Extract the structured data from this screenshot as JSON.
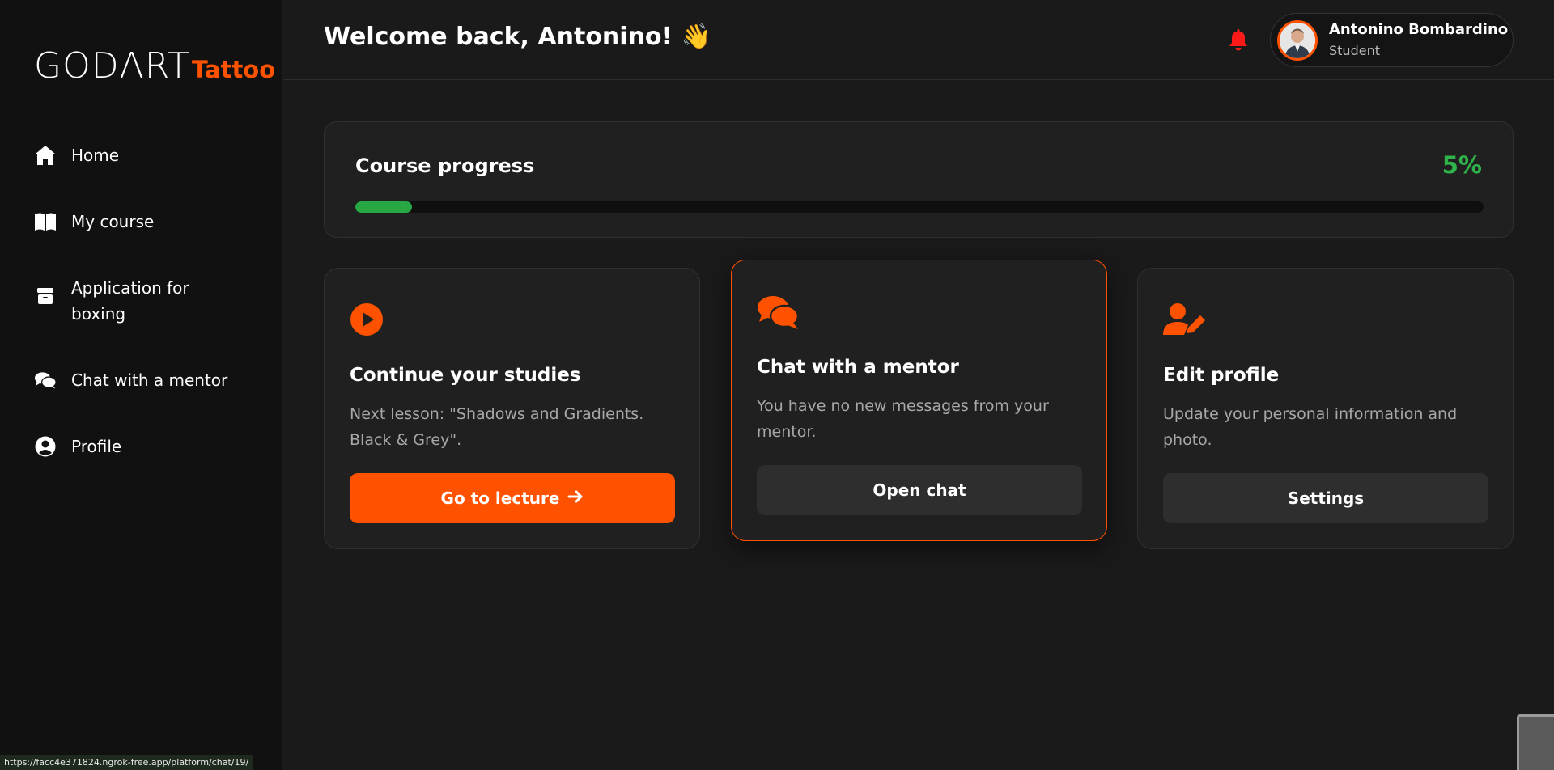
{
  "brand": {
    "logo_main": "GODΛRT",
    "logo_sub": "Tattoo",
    "accent": "#ff5200"
  },
  "sidebar": {
    "items": [
      {
        "label": "Home",
        "icon": "home-icon"
      },
      {
        "label": "My course",
        "icon": "book-open-icon"
      },
      {
        "label": "Application for boxing",
        "icon": "box-icon"
      },
      {
        "label": "Chat with a mentor",
        "icon": "chat-bubbles-icon"
      },
      {
        "label": "Profile",
        "icon": "user-circle-icon"
      }
    ]
  },
  "header": {
    "welcome": "Welcome back, Antonino! 👋",
    "notification_color": "#ff1a1a",
    "user": {
      "name": "Antonino Bombardino",
      "role": "Student"
    }
  },
  "progress": {
    "title": "Course progress",
    "percent_label": "5%",
    "percent": 5,
    "color": "#28a745"
  },
  "cards": [
    {
      "icon": "play-circle-icon",
      "title": "Continue your studies",
      "text": "Next lesson: \"Shadows and Gradients. Black & Grey\".",
      "button": "Go to lecture",
      "button_icon": "arrow-right-icon"
    },
    {
      "icon": "comments-icon",
      "title": "Chat with a mentor",
      "text": "You have no new messages from your mentor.",
      "button": "Open chat"
    },
    {
      "icon": "user-edit-icon",
      "title": "Edit profile",
      "text": "Update your personal information and photo.",
      "button": "Settings"
    }
  ],
  "statusbar": {
    "url": "https://facc4e371824.ngrok-free.app/platform/chat/19/"
  }
}
